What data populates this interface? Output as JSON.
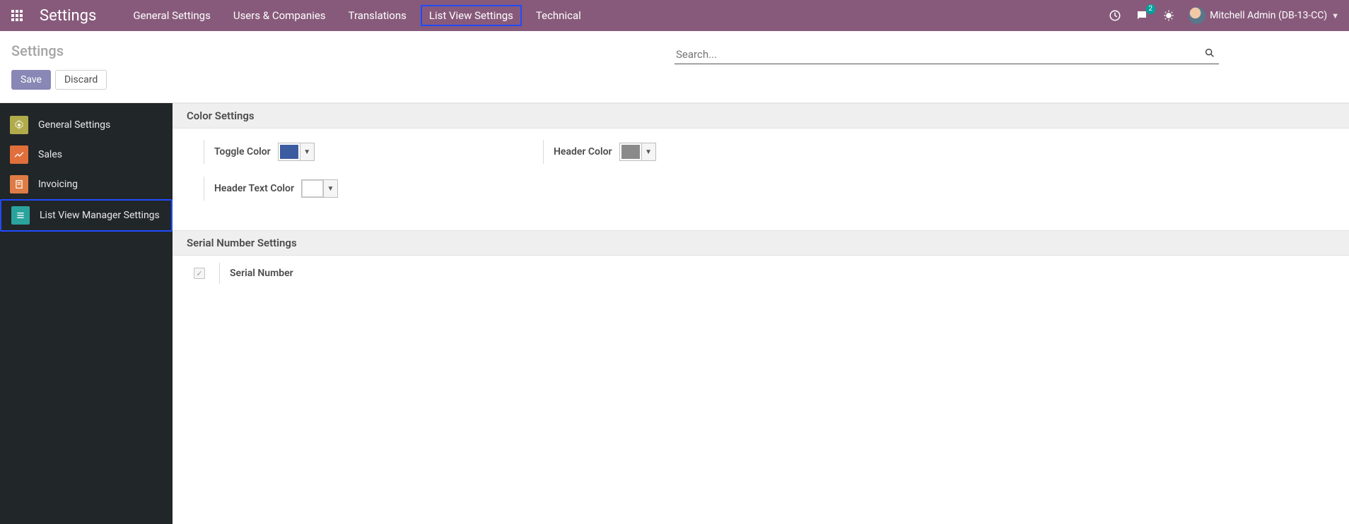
{
  "navbar": {
    "brand": "Settings",
    "menus": [
      {
        "label": "General Settings"
      },
      {
        "label": "Users & Companies"
      },
      {
        "label": "Translations"
      },
      {
        "label": "List View Settings",
        "highlighted": true
      },
      {
        "label": "Technical"
      }
    ],
    "messaging_badge": "2",
    "user_label": "Mitchell Admin (DB-13-CC)"
  },
  "breadcrumb": "Settings",
  "search": {
    "placeholder": "Search..."
  },
  "buttons": {
    "save": "Save",
    "discard": "Discard"
  },
  "sidebar": {
    "items": [
      {
        "label": "General Settings"
      },
      {
        "label": "Sales"
      },
      {
        "label": "Invoicing"
      },
      {
        "label": "List View Manager Settings",
        "highlighted": true
      }
    ]
  },
  "sections": {
    "color": {
      "title": "Color Settings",
      "toggle_label": "Toggle Color",
      "toggle_value": "#3b5ca0",
      "header_label": "Header Color",
      "header_value": "#8a8a8a",
      "header_text_label": "Header Text Color",
      "header_text_value": "#ffffff"
    },
    "serial": {
      "title": "Serial Number Settings",
      "field_label": "Serial Number",
      "checked": true
    }
  },
  "icons": {
    "dropdown_triangle": "▼",
    "check": "✓"
  }
}
